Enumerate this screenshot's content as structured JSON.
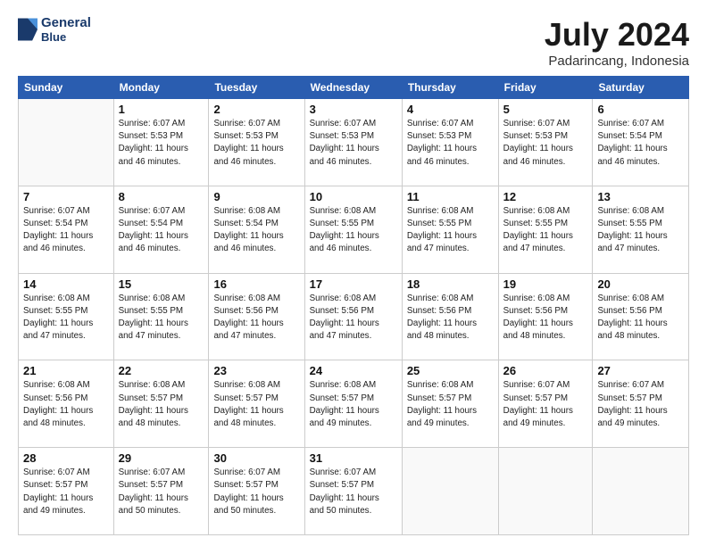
{
  "header": {
    "logo_line1": "General",
    "logo_line2": "Blue",
    "title": "July 2024",
    "subtitle": "Padarincang, Indonesia"
  },
  "calendar": {
    "days_of_week": [
      "Sunday",
      "Monday",
      "Tuesday",
      "Wednesday",
      "Thursday",
      "Friday",
      "Saturday"
    ],
    "weeks": [
      [
        {
          "day": "",
          "info": ""
        },
        {
          "day": "1",
          "info": "Sunrise: 6:07 AM\nSunset: 5:53 PM\nDaylight: 11 hours\nand 46 minutes."
        },
        {
          "day": "2",
          "info": "Sunrise: 6:07 AM\nSunset: 5:53 PM\nDaylight: 11 hours\nand 46 minutes."
        },
        {
          "day": "3",
          "info": "Sunrise: 6:07 AM\nSunset: 5:53 PM\nDaylight: 11 hours\nand 46 minutes."
        },
        {
          "day": "4",
          "info": "Sunrise: 6:07 AM\nSunset: 5:53 PM\nDaylight: 11 hours\nand 46 minutes."
        },
        {
          "day": "5",
          "info": "Sunrise: 6:07 AM\nSunset: 5:53 PM\nDaylight: 11 hours\nand 46 minutes."
        },
        {
          "day": "6",
          "info": "Sunrise: 6:07 AM\nSunset: 5:54 PM\nDaylight: 11 hours\nand 46 minutes."
        }
      ],
      [
        {
          "day": "7",
          "info": "Sunrise: 6:07 AM\nSunset: 5:54 PM\nDaylight: 11 hours\nand 46 minutes."
        },
        {
          "day": "8",
          "info": "Sunrise: 6:07 AM\nSunset: 5:54 PM\nDaylight: 11 hours\nand 46 minutes."
        },
        {
          "day": "9",
          "info": "Sunrise: 6:08 AM\nSunset: 5:54 PM\nDaylight: 11 hours\nand 46 minutes."
        },
        {
          "day": "10",
          "info": "Sunrise: 6:08 AM\nSunset: 5:55 PM\nDaylight: 11 hours\nand 46 minutes."
        },
        {
          "day": "11",
          "info": "Sunrise: 6:08 AM\nSunset: 5:55 PM\nDaylight: 11 hours\nand 47 minutes."
        },
        {
          "day": "12",
          "info": "Sunrise: 6:08 AM\nSunset: 5:55 PM\nDaylight: 11 hours\nand 47 minutes."
        },
        {
          "day": "13",
          "info": "Sunrise: 6:08 AM\nSunset: 5:55 PM\nDaylight: 11 hours\nand 47 minutes."
        }
      ],
      [
        {
          "day": "14",
          "info": "Sunrise: 6:08 AM\nSunset: 5:55 PM\nDaylight: 11 hours\nand 47 minutes."
        },
        {
          "day": "15",
          "info": "Sunrise: 6:08 AM\nSunset: 5:55 PM\nDaylight: 11 hours\nand 47 minutes."
        },
        {
          "day": "16",
          "info": "Sunrise: 6:08 AM\nSunset: 5:56 PM\nDaylight: 11 hours\nand 47 minutes."
        },
        {
          "day": "17",
          "info": "Sunrise: 6:08 AM\nSunset: 5:56 PM\nDaylight: 11 hours\nand 47 minutes."
        },
        {
          "day": "18",
          "info": "Sunrise: 6:08 AM\nSunset: 5:56 PM\nDaylight: 11 hours\nand 48 minutes."
        },
        {
          "day": "19",
          "info": "Sunrise: 6:08 AM\nSunset: 5:56 PM\nDaylight: 11 hours\nand 48 minutes."
        },
        {
          "day": "20",
          "info": "Sunrise: 6:08 AM\nSunset: 5:56 PM\nDaylight: 11 hours\nand 48 minutes."
        }
      ],
      [
        {
          "day": "21",
          "info": "Sunrise: 6:08 AM\nSunset: 5:56 PM\nDaylight: 11 hours\nand 48 minutes."
        },
        {
          "day": "22",
          "info": "Sunrise: 6:08 AM\nSunset: 5:57 PM\nDaylight: 11 hours\nand 48 minutes."
        },
        {
          "day": "23",
          "info": "Sunrise: 6:08 AM\nSunset: 5:57 PM\nDaylight: 11 hours\nand 48 minutes."
        },
        {
          "day": "24",
          "info": "Sunrise: 6:08 AM\nSunset: 5:57 PM\nDaylight: 11 hours\nand 49 minutes."
        },
        {
          "day": "25",
          "info": "Sunrise: 6:08 AM\nSunset: 5:57 PM\nDaylight: 11 hours\nand 49 minutes."
        },
        {
          "day": "26",
          "info": "Sunrise: 6:07 AM\nSunset: 5:57 PM\nDaylight: 11 hours\nand 49 minutes."
        },
        {
          "day": "27",
          "info": "Sunrise: 6:07 AM\nSunset: 5:57 PM\nDaylight: 11 hours\nand 49 minutes."
        }
      ],
      [
        {
          "day": "28",
          "info": "Sunrise: 6:07 AM\nSunset: 5:57 PM\nDaylight: 11 hours\nand 49 minutes."
        },
        {
          "day": "29",
          "info": "Sunrise: 6:07 AM\nSunset: 5:57 PM\nDaylight: 11 hours\nand 50 minutes."
        },
        {
          "day": "30",
          "info": "Sunrise: 6:07 AM\nSunset: 5:57 PM\nDaylight: 11 hours\nand 50 minutes."
        },
        {
          "day": "31",
          "info": "Sunrise: 6:07 AM\nSunset: 5:57 PM\nDaylight: 11 hours\nand 50 minutes."
        },
        {
          "day": "",
          "info": ""
        },
        {
          "day": "",
          "info": ""
        },
        {
          "day": "",
          "info": ""
        }
      ]
    ]
  }
}
